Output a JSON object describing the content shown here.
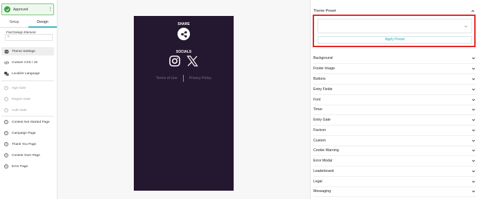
{
  "sidebar": {
    "status_label": "Approved",
    "kebab": "⋮",
    "tabs": [
      {
        "label": "Setup"
      },
      {
        "label": "Design"
      }
    ],
    "find_label": "Find Design Element",
    "find_sort_glyph": "⇅",
    "nav_main": [
      {
        "label": "Theme Settings"
      },
      {
        "label": "Custom CSS / JS"
      },
      {
        "label": "Localize Language"
      }
    ],
    "nav_gates": [
      {
        "label": "Age Gate"
      },
      {
        "label": "Region Gate"
      },
      {
        "label": "Auth Gate"
      }
    ],
    "nav_pages": [
      {
        "num": "1",
        "label": "Contest Not Started Page"
      },
      {
        "num": "2",
        "label": "Campaign Page"
      },
      {
        "num": "3",
        "label": "Thank You Page"
      },
      {
        "num": "4",
        "label": "Contest Over Page"
      },
      {
        "num": "5",
        "label": "Error Page"
      }
    ]
  },
  "canvas": {
    "share_title": "SHARE",
    "socials_title": "SOCIALS",
    "footer_links": [
      "Terms of Use",
      "Privacy Policy"
    ],
    "background": "#241730"
  },
  "panel": {
    "preset_title": "Theme Preset",
    "apply_label": "Apply Preset",
    "sections": [
      "Background",
      "Footer Image",
      "Buttons",
      "Entry Fields",
      "Font",
      "Timer",
      "Entry Gate",
      "Favicon",
      "Custom",
      "Cookie Warning",
      "Error Modal",
      "Leaderboard",
      "Legal",
      "Messaging"
    ]
  },
  "colors": {
    "accent": "#3bb3c3",
    "approved_green": "#3aa244",
    "highlight_red": "#e32623"
  }
}
